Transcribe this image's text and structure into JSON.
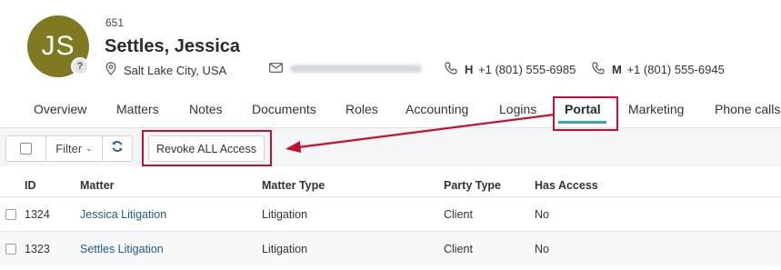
{
  "contact": {
    "initials": "JS",
    "badge": "?",
    "id": "651",
    "name": "Settles, Jessica",
    "location": "Salt Lake City, USA",
    "phone_home_label": "H",
    "phone_home": "+1 (801) 555-6985",
    "phone_mobile_label": "M",
    "phone_mobile": "+1 (801) 555-6945"
  },
  "tabs": [
    {
      "label": "Overview"
    },
    {
      "label": "Matters"
    },
    {
      "label": "Notes"
    },
    {
      "label": "Documents"
    },
    {
      "label": "Roles"
    },
    {
      "label": "Accounting"
    },
    {
      "label": "Logins"
    },
    {
      "label": "Portal",
      "active": true
    },
    {
      "label": "Marketing"
    },
    {
      "label": "Phone calls"
    }
  ],
  "toolbar": {
    "filter_label": "Filter",
    "revoke_label": "Revoke ALL Access"
  },
  "table": {
    "headers": {
      "id": "ID",
      "matter": "Matter",
      "matter_type": "Matter Type",
      "party_type": "Party Type",
      "has_access": "Has Access"
    },
    "rows": [
      {
        "id": "1324",
        "matter": "Jessica Litigation",
        "matter_type": "Litigation",
        "party_type": "Client",
        "has_access": "No"
      },
      {
        "id": "1323",
        "matter": "Settles Litigation",
        "matter_type": "Litigation",
        "party_type": "Client",
        "has_access": "No"
      }
    ]
  },
  "colors": {
    "avatar": "#7f7a22",
    "active_tab_underline": "#3fa2a8",
    "link": "#1f5a8a",
    "annotation": "#c8102e"
  },
  "icons": {
    "location": "map-pin-icon",
    "email": "envelope-icon",
    "phone": "phone-icon",
    "refresh": "refresh-icon"
  }
}
